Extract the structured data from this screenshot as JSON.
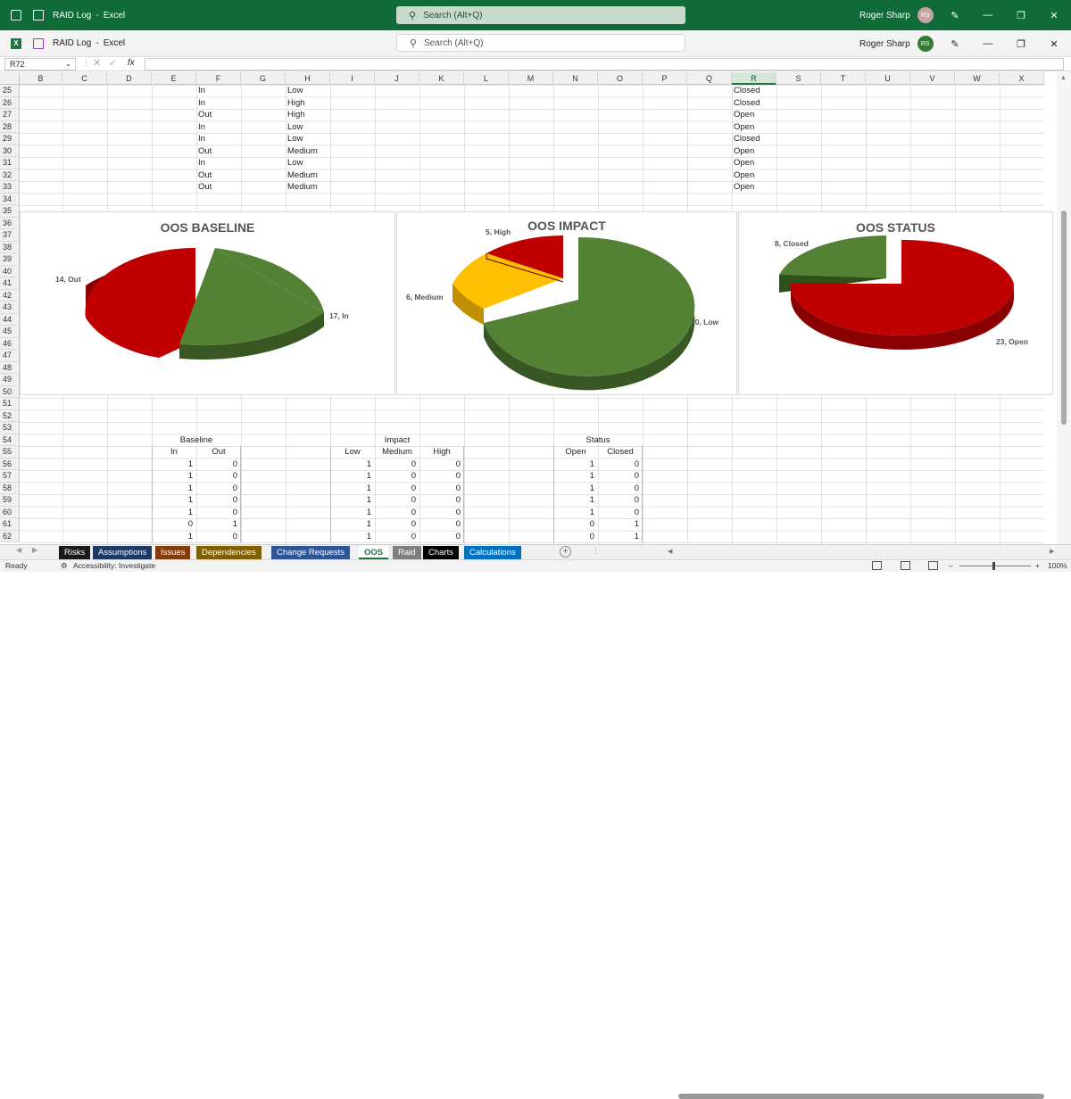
{
  "window": {
    "title_bar": {
      "doc_title": "RAID Log",
      "app_name": "Excel",
      "separator": "-",
      "search_placeholder": "Search (Alt+Q)",
      "user_name": "Roger Sharp",
      "user_initials": "RS",
      "bg_color": "#0f6b37"
    },
    "title_bar2": {
      "doc_title": "RAID Log",
      "app_name": "Excel",
      "separator": "-",
      "search_placeholder": "Search (Alt+Q)",
      "user_name": "Roger Sharp",
      "user_initials": "RS"
    }
  },
  "formula_bar": {
    "name_box": "R72",
    "fx_label": "fx",
    "formula": ""
  },
  "columns": [
    "B",
    "C",
    "D",
    "E",
    "F",
    "G",
    "H",
    "I",
    "J",
    "K",
    "L",
    "M",
    "N",
    "O",
    "P",
    "Q",
    "R",
    "S",
    "T",
    "U",
    "V",
    "W",
    "X"
  ],
  "selected_column": "R",
  "rows": [
    "25",
    "26",
    "27",
    "28",
    "29",
    "30",
    "31",
    "32",
    "33",
    "34",
    "35",
    "36",
    "37",
    "38",
    "39",
    "40",
    "41",
    "42",
    "43",
    "44",
    "45",
    "46",
    "47",
    "48",
    "49",
    "50",
    "51",
    "52",
    "53",
    "54",
    "55",
    "56",
    "57",
    "58",
    "59",
    "60",
    "61",
    "62"
  ],
  "data_rows": [
    {
      "baseline": "In",
      "impact": "Low",
      "status": "Closed"
    },
    {
      "baseline": "In",
      "impact": "High",
      "status": "Closed"
    },
    {
      "baseline": "Out",
      "impact": "High",
      "status": "Open"
    },
    {
      "baseline": "In",
      "impact": "Low",
      "status": "Open"
    },
    {
      "baseline": "In",
      "impact": "Low",
      "status": "Closed"
    },
    {
      "baseline": "Out",
      "impact": "Medium",
      "status": "Open"
    },
    {
      "baseline": "In",
      "impact": "Low",
      "status": "Open"
    },
    {
      "baseline": "Out",
      "impact": "Medium",
      "status": "Open"
    },
    {
      "baseline": "Out",
      "impact": "Medium",
      "status": "Open"
    }
  ],
  "summary": {
    "baseline": {
      "header": "Baseline",
      "cols": [
        "In",
        "Out"
      ]
    },
    "impact": {
      "header": "Impact",
      "cols": [
        "Low",
        "Medium",
        "High"
      ]
    },
    "status": {
      "header": "Status",
      "cols": [
        "Open",
        "Closed"
      ]
    },
    "rows": [
      {
        "b": [
          "1",
          "0"
        ],
        "i": [
          "1",
          "0",
          "0"
        ],
        "s": [
          "1",
          "0"
        ]
      },
      {
        "b": [
          "1",
          "0"
        ],
        "i": [
          "1",
          "0",
          "0"
        ],
        "s": [
          "1",
          "0"
        ]
      },
      {
        "b": [
          "1",
          "0"
        ],
        "i": [
          "1",
          "0",
          "0"
        ],
        "s": [
          "1",
          "0"
        ]
      },
      {
        "b": [
          "1",
          "0"
        ],
        "i": [
          "1",
          "0",
          "0"
        ],
        "s": [
          "1",
          "0"
        ]
      },
      {
        "b": [
          "1",
          "0"
        ],
        "i": [
          "1",
          "0",
          "0"
        ],
        "s": [
          "1",
          "0"
        ]
      },
      {
        "b": [
          "0",
          "1"
        ],
        "i": [
          "1",
          "0",
          "0"
        ],
        "s": [
          "0",
          "1"
        ]
      },
      {
        "b": [
          "1",
          "0"
        ],
        "i": [
          "1",
          "0",
          "0"
        ],
        "s": [
          "0",
          "1"
        ]
      }
    ]
  },
  "chart_data": [
    {
      "type": "pie",
      "title": "OOS BASELINE",
      "slices": [
        {
          "label": "In",
          "value": 17,
          "color": "#548235"
        },
        {
          "label": "Out",
          "value": 14,
          "color": "#c00000"
        }
      ],
      "data_labels": [
        "17, In",
        "14, Out"
      ]
    },
    {
      "type": "pie",
      "title": "OOS IMPACT",
      "slices": [
        {
          "label": "Low",
          "value": 20,
          "color": "#548235"
        },
        {
          "label": "Medium",
          "value": 6,
          "color": "#ffc000"
        },
        {
          "label": "High",
          "value": 5,
          "color": "#c00000"
        }
      ],
      "data_labels": [
        "20, Low",
        "6, Medium",
        "5, High"
      ]
    },
    {
      "type": "pie",
      "title": "OOS STATUS",
      "slices": [
        {
          "label": "Open",
          "value": 23,
          "color": "#c00000"
        },
        {
          "label": "Closed",
          "value": 8,
          "color": "#548235"
        }
      ],
      "data_labels": [
        "23, Open",
        "8, Closed"
      ]
    }
  ],
  "sheet_tabs": [
    {
      "label": "Risks",
      "color": "#1a1a1a"
    },
    {
      "label": "Assumptions",
      "color": "#1f3864"
    },
    {
      "label": "Issues",
      "color": "#843c0c"
    },
    {
      "label": "Dependencies",
      "color": "#7f6000"
    },
    {
      "label": "Change Requests",
      "color": "#2f5597"
    },
    {
      "label": "OOS",
      "color": "#ffffff"
    },
    {
      "label": "Raid",
      "color": "#7f7f7f"
    },
    {
      "label": "Charts",
      "color": "#000000"
    },
    {
      "label": "Calculations",
      "color": "#0070c0"
    }
  ],
  "active_tab": "OOS",
  "status_bar": {
    "ready": "Ready",
    "accessibility": "Accessibility: Investigate",
    "zoom": "100%"
  }
}
